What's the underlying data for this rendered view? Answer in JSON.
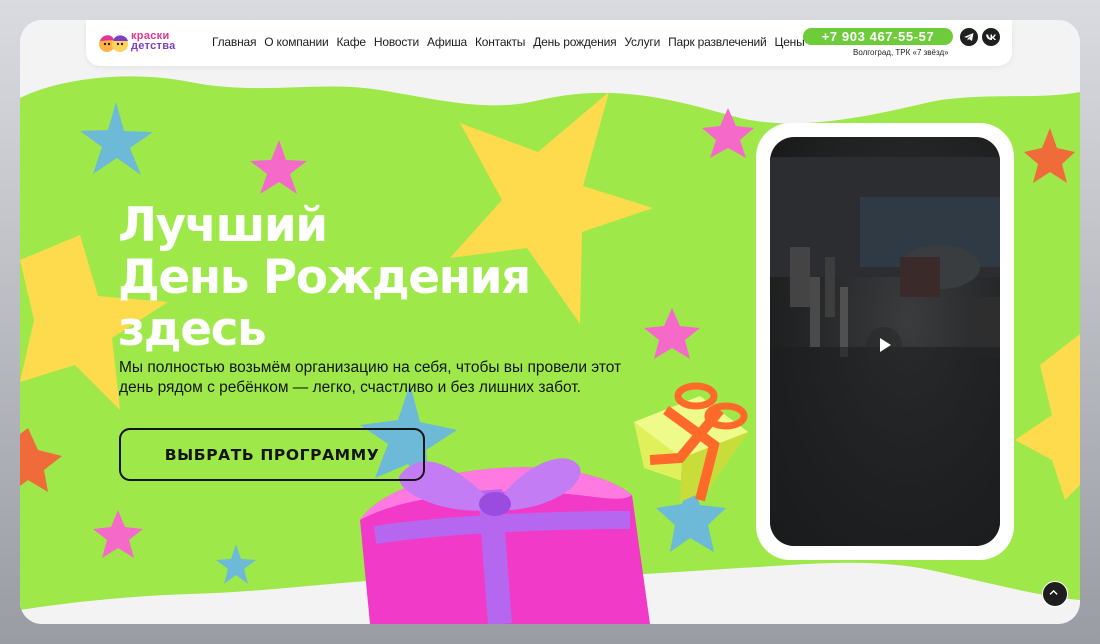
{
  "header": {
    "logo": {
      "line1": "краски",
      "line2": "детства"
    },
    "nav": [
      "Главная",
      "О компании",
      "Кафе",
      "Новости",
      "Афиша",
      "Контакты",
      "День рождения",
      "Услуги",
      "Парк развлечений",
      "Цены"
    ],
    "phone": "+7 903 467-55-57",
    "address": "Волгоград, ТРК «7 звёзд»",
    "social": [
      "telegram-icon",
      "vk-icon"
    ]
  },
  "hero": {
    "title_lines": [
      "Лучший",
      "День Рождения",
      "здесь"
    ],
    "subtitle": "Мы полностью возьмём организацию на себя, чтобы вы провели этот день рядом с ребёнком — легко, счастливо и без лишних забот.",
    "cta_label": "ВЫБРАТЬ ПРОГРАММУ"
  },
  "video": {
    "icon": "play-icon"
  },
  "colors": {
    "green_bg": "#9ee84a",
    "phone_green": "#6ecb3a",
    "star_yellow": "#fedb4c",
    "star_pink": "#f56ac9",
    "star_blue": "#6cb9d8",
    "star_orange": "#f06b3a",
    "gift_pink": "#f23ac8",
    "gift_ribbon": "#b567f0"
  }
}
